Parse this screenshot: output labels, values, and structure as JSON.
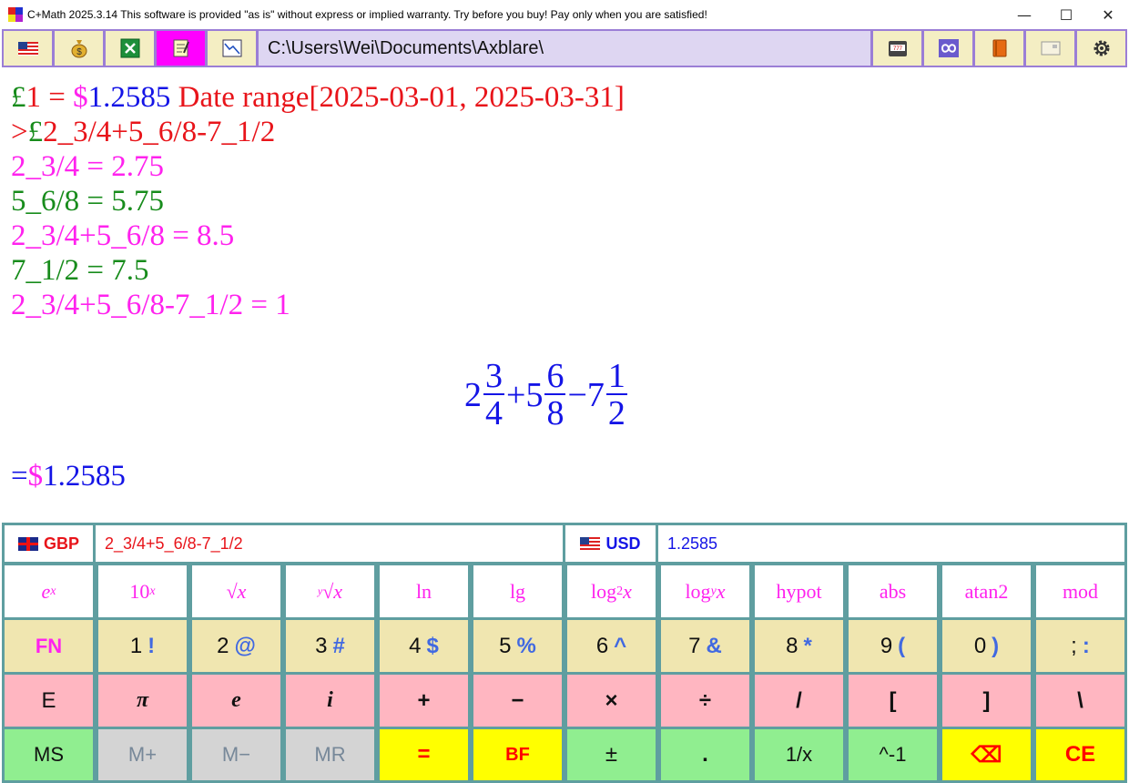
{
  "window": {
    "title": "C+Math 2025.3.14 This software is provided \"as is\" without express or implied warranty. Try before you buy! Pay only when you are satisfied!",
    "minimize": "—",
    "maximize": "☐",
    "close": "✕"
  },
  "toolbar": {
    "left_icons": [
      "us-flag-icon",
      "money-bag-icon",
      "excel-icon",
      "notepad-icon",
      "chart-icon"
    ],
    "right_icons": [
      "slot-machine-icon",
      "infinity-icon",
      "book-icon",
      "card-icon",
      "settings-icon"
    ],
    "path": "C:\\Users\\Wei\\Documents\\Axblare\\"
  },
  "output": {
    "rate_gbp": "£",
    "rate_gbp_val": "1",
    "rate_eq": " = ",
    "rate_usd": "$",
    "rate_usd_val": "1.2585",
    "rate_range": " Date range[2025-03-01, 2025-03-31]",
    "prompt_gt": ">",
    "prompt_pound": "£",
    "prompt_expr": "2_3/4+5_6/8-7_1/2",
    "step1": "2_3/4 = 2.75",
    "step2": "5_6/8 = 5.75",
    "step3": "2_3/4+5_6/8 = 8.5",
    "step4": "7_1/2 = 7.5",
    "step5": "2_3/4+5_6/8-7_1/2 = 1",
    "formula": {
      "w1": "2",
      "n1": "3",
      "d1": "4",
      "op1": "+",
      "w2": "5",
      "n2": "6",
      "d2": "8",
      "op2": "−",
      "w3": "7",
      "n3": "1",
      "d3": "2"
    },
    "result_eq": "=",
    "result_dollar": "$",
    "result_val": "1.2585"
  },
  "converter": {
    "from_currency": "GBP",
    "from_value": "2_3/4+5_6/8-7_1/2",
    "to_currency": "USD",
    "to_value": "1.2585"
  },
  "keys": {
    "fn_row": [
      "ln",
      "lg",
      "hypot",
      "abs",
      "atan2",
      "mod"
    ],
    "fn_special": {
      "ex_base": "e",
      "ex_exp": "x",
      "tenx_base": "10",
      "tenx_exp": "x",
      "sqrt": "√x",
      "nroot_idx": "y",
      "nroot": "√x",
      "log2_a": "log",
      "log2_sub": "2",
      "log2_x": "x",
      "logy_a": "log",
      "logy_sub": "y",
      "logy_x": "x"
    },
    "num_row": [
      {
        "main": "FN",
        "shift": ""
      },
      {
        "main": "1",
        "shift": "!"
      },
      {
        "main": "2",
        "shift": "@"
      },
      {
        "main": "3",
        "shift": "#"
      },
      {
        "main": "4",
        "shift": "$"
      },
      {
        "main": "5",
        "shift": "%"
      },
      {
        "main": "6",
        "shift": "^"
      },
      {
        "main": "7",
        "shift": "&"
      },
      {
        "main": "8",
        "shift": "*"
      },
      {
        "main": "9",
        "shift": "("
      },
      {
        "main": "0",
        "shift": ")"
      },
      {
        "main": ";",
        "shift": ":"
      }
    ],
    "op_row": [
      "E",
      "π",
      "e",
      "i",
      "+",
      "−",
      "×",
      "÷",
      "/",
      "[",
      "]",
      "\\"
    ],
    "bottom_row": [
      "MS",
      "M+",
      "M−",
      "MR",
      "=",
      "BF",
      "±",
      ".",
      "1/x",
      "^-1",
      "⌫",
      "CE"
    ]
  }
}
